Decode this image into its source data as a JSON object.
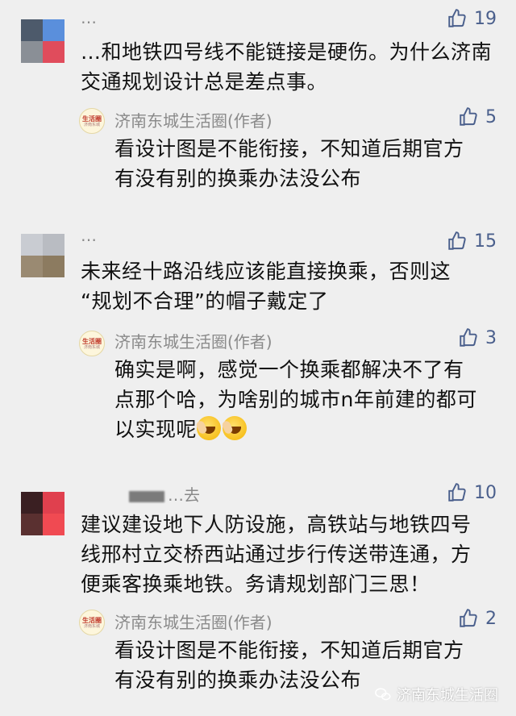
{
  "comments": [
    {
      "username": "…",
      "likes": "19",
      "lines": [
        "…和地铁四号线不能链接是硬伤。为什么济南",
        "交通规划设计总是差点事。"
      ],
      "avatar_colors": [
        "#4d5a6b",
        "#5a8fdc",
        "#8a8f96",
        "#e04c5c"
      ],
      "reply": {
        "author": "济南东城生活圈(作者)",
        "likes": "5",
        "lines": [
          "看设计图是不能衔接，不知道后期官方",
          "有没有别的换乘办法没公布"
        ]
      }
    },
    {
      "username": "…",
      "likes": "15",
      "lines": [
        "未来经十路沿线应该能直接换乘，否则这",
        "“规划不合理”的帽子戴定了"
      ],
      "avatar_colors": [
        "#c9ccd2",
        "#b9bcc2",
        "#9a8a72",
        "#8c7b60"
      ],
      "reply": {
        "author": "济南东城生活圈(作者)",
        "likes": "3",
        "lines": [
          "确实是啊，感觉一个换乘都解决不了有",
          "点那个哈，为啥别的城市n年前建的都可",
          "以实现呢"
        ]
      }
    },
    {
      "username": "…去",
      "likes": "10",
      "lines": [
        "建议建设地下人防设施，高铁站与地铁四号",
        "线邢村立交桥西站通过步行传送带连通，方",
        "便乘客换乘地铁。务请规划部门三思！"
      ],
      "avatar_colors": [
        "#3a1f22",
        "#e0404e",
        "#5a3030",
        "#f04a52"
      ],
      "reply": {
        "author": "济南东城生活圈(作者)",
        "likes": "2",
        "lines": [
          "看设计图是不能衔接，不知道后期官方",
          "有没有别的换乘办法没公布"
        ]
      }
    }
  ],
  "reply_avatar": {
    "line1": "生活圈",
    "line2": "济南东城"
  },
  "like_icon": "thumbs-up-icon",
  "watermark": "济南东城生活圈",
  "colors": {
    "background": "#efefef",
    "like": "#4a5f8c",
    "meta": "#8a8a8a"
  }
}
